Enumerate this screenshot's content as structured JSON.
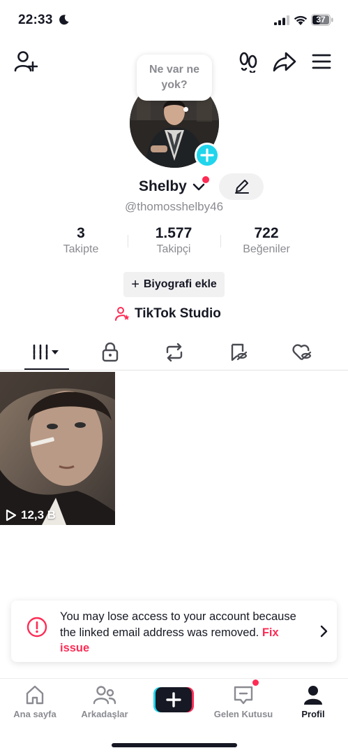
{
  "status_bar": {
    "time": "22:33",
    "battery": "37"
  },
  "bubble": {
    "text_line1": "Ne var ne",
    "text_line2": "yok?"
  },
  "profile": {
    "name": "Shelby",
    "handle": "@thomosshelby46"
  },
  "stats": [
    {
      "value": "3",
      "label": "Takipte"
    },
    {
      "value": "1.577",
      "label": "Takipçi"
    },
    {
      "value": "722",
      "label": "Beğeniler"
    }
  ],
  "bio_button": {
    "label": "Biyografi ekle",
    "icon": "+"
  },
  "studio": {
    "label": "TikTok Studio"
  },
  "videos": [
    {
      "views": "12,3 B"
    }
  ],
  "notice": {
    "text": "You may lose access to your account because the linked email address was removed.",
    "link": "Fix issue"
  },
  "bottom_nav": [
    {
      "label": "Ana sayfa",
      "icon": "home-icon"
    },
    {
      "label": "Arkadaşlar",
      "icon": "friends-icon"
    },
    {
      "label": "",
      "icon": "create-icon"
    },
    {
      "label": "Gelen Kutusu",
      "icon": "inbox-icon"
    },
    {
      "label": "Profil",
      "icon": "profile-icon"
    }
  ],
  "colors": {
    "accent": "#fe2c55",
    "cyan": "#20d5ec",
    "text": "#161823",
    "muted": "#8a8b91"
  }
}
